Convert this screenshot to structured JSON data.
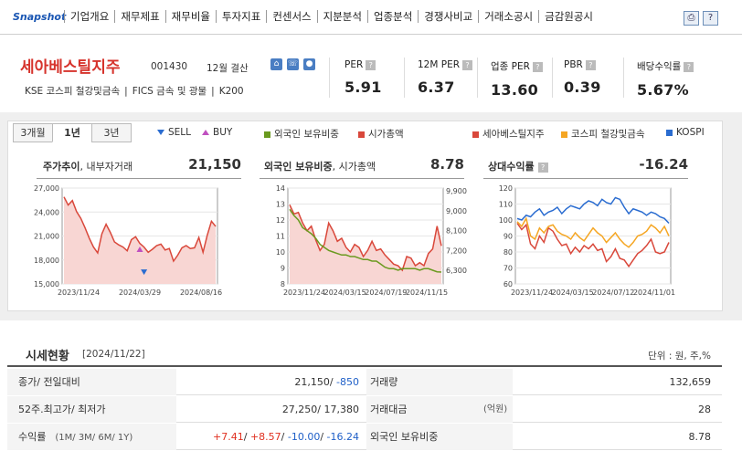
{
  "nav": {
    "logo": "Snapshot",
    "tabs": [
      "기업개요",
      "재무제표",
      "재무비율",
      "투자지표",
      "컨센서스",
      "지분분석",
      "업종분석",
      "경쟁사비교",
      "거래소공시",
      "금감원공시"
    ]
  },
  "company": {
    "name": "세아베스틸지주",
    "code": "001430",
    "settlement": "12월 결산",
    "info": [
      "KSE  코스피 철강및금속",
      "FICS 금속 및 광물",
      "K200"
    ]
  },
  "metrics": [
    {
      "label": "PER",
      "value": "5.91"
    },
    {
      "label": "12M PER",
      "value": "6.37"
    },
    {
      "label": "업종 PER",
      "value": "13.60"
    },
    {
      "label": "PBR",
      "value": "0.39"
    },
    {
      "label": "배당수익률",
      "value": "5.67%"
    }
  ],
  "period_tabs": [
    "3개월",
    "1년",
    "3년"
  ],
  "legend": {
    "sell": "SELL",
    "buy": "BUY",
    "foreign": "외국인 보유비중",
    "mcap": "시가총액",
    "company": "세아베스틸지주",
    "sector": "코스피 철강및금속",
    "kospi": "KOSPI"
  },
  "colors": {
    "red": "#d9483b",
    "green": "#6a9a1f",
    "orange": "#f5a623",
    "blue": "#2a6cd0"
  },
  "charts": {
    "price": {
      "title": "주가추이",
      "sub": ", 내부자거래",
      "value": "21,150"
    },
    "foreign": {
      "title": "외국인 보유비중",
      "sub": ", 시가총액",
      "value": "8.78"
    },
    "relative": {
      "title": "상대수익률",
      "value": "-16.24"
    }
  },
  "chart_data": [
    {
      "type": "area",
      "x": [
        "2023/11/24",
        "2024/03/29",
        "2024/08/16"
      ],
      "y_ticks": [
        "27,000",
        "24,000",
        "21,000",
        "18,000",
        "15,000"
      ],
      "ylim": [
        15000,
        28000
      ],
      "series": [
        {
          "values": [
            26800,
            25700,
            26300,
            24800,
            23900,
            22600,
            21200,
            20000,
            19200,
            21800,
            23100,
            22000,
            20700,
            20300,
            20000,
            19500,
            21000,
            21400,
            20500,
            20000,
            19300,
            19700,
            20200,
            20400,
            19600,
            19800,
            18100,
            18900,
            19900,
            20200,
            19800,
            19900,
            21300,
            19300,
            21600,
            23500,
            22800
          ]
        }
      ],
      "markers": [
        {
          "kind": "BUY",
          "index": 18,
          "value": 19700
        },
        {
          "kind": "SELL",
          "index": 19,
          "value": 16600
        }
      ]
    },
    {
      "type": "line",
      "x": [
        "2023/11/24",
        "2024/03/15",
        "2024/07/19",
        "2024/11/15"
      ],
      "y_ticks_left": [
        "14",
        "13",
        "12",
        "11",
        "10",
        "9",
        "8"
      ],
      "y_ticks_right": [
        "9,900",
        "9,000",
        "8,100",
        "7,200",
        "6,300"
      ],
      "ylim": [
        8,
        14.3
      ],
      "series": [
        {
          "name": "외국인 보유비중",
          "values": [
            12.9,
            12.5,
            12.2,
            11.7,
            11.5,
            11.3,
            11.0,
            10.6,
            10.4,
            10.2,
            10.1,
            10.0,
            9.9,
            9.9,
            9.8,
            9.8,
            9.7,
            9.6,
            9.6,
            9.5,
            9.5,
            9.3,
            9.1,
            9.0,
            9.0,
            8.9,
            9.0,
            9.0,
            9.0,
            9.0,
            8.9,
            9.0,
            9.0,
            8.9,
            8.8,
            8.78
          ]
        },
        {
          "name": "시가총액",
          "values": [
            13.2,
            12.6,
            12.7,
            12.0,
            11.5,
            11.8,
            10.9,
            10.2,
            10.6,
            12.0,
            11.5,
            10.8,
            11.0,
            10.4,
            10.1,
            10.6,
            10.4,
            9.8,
            10.2,
            10.8,
            10.2,
            10.3,
            9.9,
            9.6,
            9.3,
            9.2,
            8.9,
            9.8,
            9.7,
            9.2,
            9.4,
            9.2,
            10.0,
            10.3,
            11.8,
            10.5
          ]
        }
      ]
    },
    {
      "type": "line",
      "x": [
        "2023/11/24",
        "2024/03/15",
        "2024/07/12",
        "2024/11/01"
      ],
      "y_ticks": [
        "120",
        "110",
        "100",
        "90",
        "80",
        "70",
        "60"
      ],
      "ylim": [
        60,
        120
      ],
      "series": [
        {
          "name": "세아베스틸지주",
          "values": [
            98,
            94,
            97,
            85,
            82,
            90,
            86,
            95,
            93,
            88,
            84,
            85,
            79,
            83,
            80,
            84,
            82,
            85,
            81,
            82,
            74,
            77,
            82,
            76,
            75,
            71,
            75,
            79,
            81,
            84,
            88,
            80,
            79,
            80,
            86
          ]
        },
        {
          "name": "코스피 철강및금속",
          "values": [
            99,
            96,
            101,
            90,
            88,
            95,
            92,
            96,
            97,
            93,
            91,
            90,
            88,
            92,
            89,
            87,
            91,
            95,
            92,
            90,
            86,
            89,
            92,
            88,
            85,
            83,
            86,
            90,
            91,
            93,
            97,
            95,
            92,
            96,
            90
          ]
        },
        {
          "name": "KOSPI",
          "values": [
            101,
            100,
            103,
            102,
            105,
            107,
            103,
            105,
            106,
            108,
            104,
            107,
            109,
            108,
            107,
            110,
            112,
            111,
            109,
            113,
            111,
            110,
            114,
            113,
            108,
            104,
            107,
            106,
            105,
            103,
            105,
            104,
            102,
            101,
            98
          ]
        }
      ]
    }
  ],
  "summary": {
    "title": "시세현황",
    "date": "[2024/11/22]",
    "unit": "단위 : 원, 주,%",
    "rows": [
      {
        "l1": "종가/ 전일대비",
        "v1a": "21,150/ ",
        "v1b": "-850",
        "l2": "거래량",
        "v2": "132,659"
      },
      {
        "l1": "52주.최고가/ 최저가",
        "v1a": "27,250/ 17,380",
        "v1b": "",
        "l2": "거래대금",
        "unit2": "(억원)",
        "v2": "28"
      },
      {
        "l1": "수익률",
        "sub1": "(1M/ 3M/ 6M/ 1Y)",
        "r": [
          "+7.41",
          "+8.57",
          "-10.00",
          "-16.24"
        ],
        "l2": "외국인 보유비중",
        "v2": "8.78"
      }
    ]
  }
}
